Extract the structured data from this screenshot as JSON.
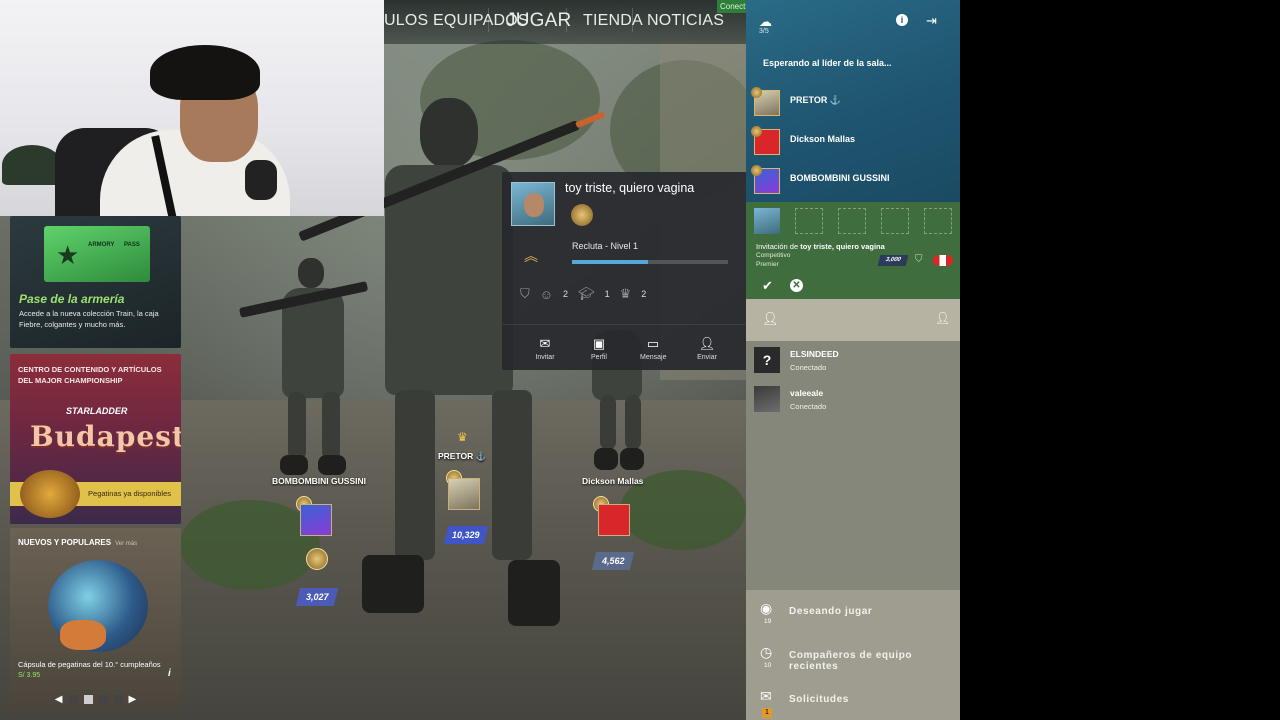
{
  "topnav": {
    "items": [
      "ULOS EQUIPADOS",
      "JUGAR",
      "TIENDA",
      "NOTICIAS"
    ],
    "status": "Conect"
  },
  "promos": {
    "armory": {
      "card_tag": "ARMORY",
      "card_tag2": "PASS",
      "title": "Pase de la armería",
      "desc": "Accede a la nueva colección Train, la caja Fiebre, colgantes y mucho más."
    },
    "major": {
      "header": "CENTRO DE CONTENIDO Y ARTÍCULOS DEL MAJOR CHAMPIONSHIP",
      "sponsor": "STARLADDER",
      "city": "Budapest",
      "bar_text": "Pegatinas ya disponibles"
    },
    "new": {
      "header": "NUEVOS Y POPULARES",
      "view_more": "Ver más",
      "caption": "Cápsula de pegatinas del 10.° cumpleaños",
      "price": "S/ 3.95"
    },
    "pager_active": 1
  },
  "lobby": {
    "players": [
      {
        "name": "BOMBOMBINI GUSSINI",
        "rank": "3,027",
        "rank_color": "#4b5bb7"
      },
      {
        "name": "PRETOR ⚓",
        "rank": "10,329",
        "rank_color": "#3f55c8",
        "leader": true
      },
      {
        "name": "Dickson Mallas",
        "rank": "4,562",
        "rank_color": "#5a6a8a"
      }
    ]
  },
  "popup": {
    "name": "toy triste, quiero vagina",
    "level": "Recluta - Nivel 1",
    "xp_fraction": 0.49,
    "stats": {
      "friendly": "2",
      "teacher": "1",
      "leader": "2"
    },
    "actions": [
      "Invitar",
      "Perfil",
      "Mensaje",
      "Enviar"
    ]
  },
  "party": {
    "count": "3/5",
    "waiting": "Esperando al líder de la sala...",
    "members": [
      "PRETOR ⚓",
      "Dickson Mallas",
      "BOMBOMBINI GUSSINI"
    ]
  },
  "invite": {
    "prefix": "Invitación de ",
    "from": "toy triste, quiero vagina",
    "mode": "Competitivo",
    "type": "Premier",
    "rank": "3,000"
  },
  "search": {
    "placeholder": ""
  },
  "friends": [
    {
      "name": "ELSINDEED",
      "status": "Conectado",
      "avatar": "?"
    },
    {
      "name": "valeeale",
      "status": "Conectado",
      "avatar": ""
    }
  ],
  "bottom": {
    "wanting": {
      "label": "Deseando jugar",
      "count": "19"
    },
    "recent": {
      "label": "Compañeros de equipo recientes",
      "count": "10"
    },
    "requests": {
      "label": "Solicitudes",
      "count": "1"
    }
  },
  "colors": {
    "party_bg": "#1f5570",
    "invite_bg": "#3f6d3d",
    "panel_bg": "#86877b",
    "accent_green": "#9be36d"
  }
}
